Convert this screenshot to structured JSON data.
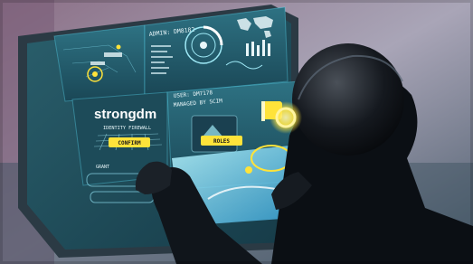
{
  "scene": {
    "admin_label": "ADMIN: DM8182",
    "user_label": "USER: DM7178",
    "managed_by": "MANAGED BY SCIM",
    "brand": "strongdm",
    "subtitle": "IDENTITY FIREWALL",
    "confirm_button": "CONFIRM",
    "roles_button": "ROLES",
    "grant_label": "GRANT"
  },
  "colors": {
    "accent_yellow": "#ffe33a",
    "panel_teal": "#1f5060",
    "glow_cyan": "#5fe6ff",
    "bg_dark": "#0b0f14"
  }
}
